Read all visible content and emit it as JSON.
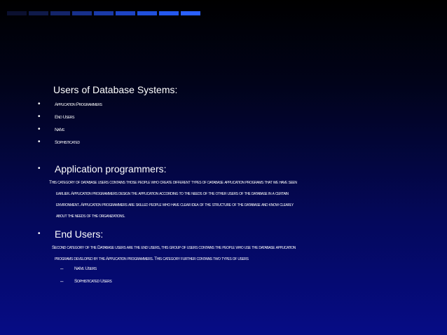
{
  "topbar": {
    "colors": [
      "#0b1030",
      "#0f1a4a",
      "#13246a",
      "#17308a",
      "#1a3aa8",
      "#1d44c4",
      "#2050dc",
      "#2458ee",
      "#2a60ff"
    ]
  },
  "heading": "Users of Database Systems:",
  "types": [
    "Application Programmers",
    "End Users",
    "Naïve",
    "Sophisticated"
  ],
  "bullet_symbol": "•",
  "dash_symbol": "–",
  "section1": {
    "title": "Application programmers:",
    "lines": [
      "This category of database users contains those people who create different types of database application programs that we have seen",
      "earlier. Application programmers design the application according to the needs of the other users of the database in a certain",
      "environment. Application programmers are skilled people who have clear idea of the structure of the database and know clearly",
      "about the needs of the organizations."
    ]
  },
  "section2": {
    "title": "End Users:",
    "lines": [
      "Second category of the Database users are the end users, this group of users contains the people who use the database application",
      "programs developed by the Application programmers. This category further contains two types of users"
    ],
    "subtypes": [
      "Naïve Users",
      "Sophisticated Users"
    ]
  }
}
